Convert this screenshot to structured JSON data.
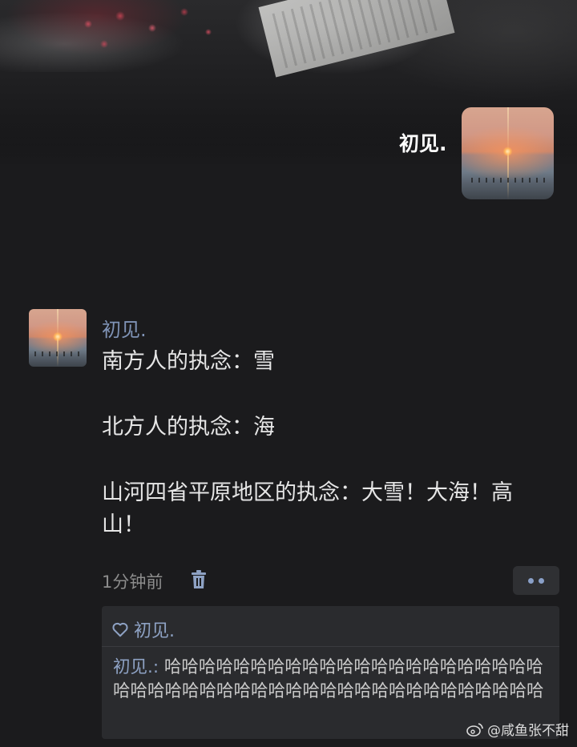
{
  "profile": {
    "name": "初见."
  },
  "post": {
    "author": "初见.",
    "lines": [
      "南方人的执念：雪",
      "北方人的执念：海",
      "山河四省平原地区的执念：大雪！大海！高山！"
    ],
    "time": "1分钟前"
  },
  "likes": {
    "names": "初见."
  },
  "comment": {
    "author": "初见.:",
    "text": "哈哈哈哈哈哈哈哈哈哈哈哈哈哈哈哈哈哈哈哈哈哈哈哈哈哈哈哈哈哈哈哈哈哈哈哈哈哈哈哈哈哈哈哈哈哈哈"
  },
  "watermark": {
    "text": "@咸鱼张不甜"
  },
  "icons": {
    "delete": "trash-icon",
    "more": "more-dots-icon",
    "like": "heart-icon",
    "brand": "weibo-icon"
  },
  "colors": {
    "background": "#1b1b1d",
    "link": "#7f93b6",
    "comment_box": "#2a2b2e"
  }
}
